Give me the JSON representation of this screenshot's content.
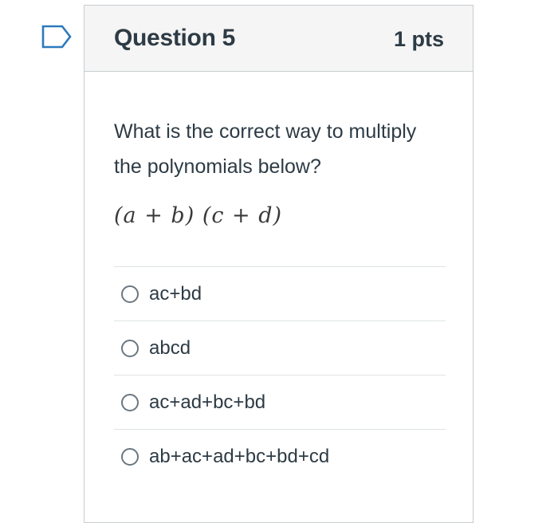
{
  "question": {
    "title": "Question 5",
    "points": "1 pts",
    "text": "What is the correct way to multiply the polynomials below?",
    "math": "(a + b) (c + d)"
  },
  "answers": [
    {
      "label": "ac+bd",
      "selected": false
    },
    {
      "label": "abcd",
      "selected": false
    },
    {
      "label": "ac+ad+bc+bd",
      "selected": false
    },
    {
      "label": "ab+ac+ad+bc+bd+cd",
      "selected": false
    }
  ],
  "icons": {
    "flag": "flag-question-icon",
    "radio": "radio-unselected-icon"
  },
  "colors": {
    "flag_stroke": "#2b7abc",
    "header_bg": "#f5f5f5",
    "text": "#2d3b45"
  }
}
